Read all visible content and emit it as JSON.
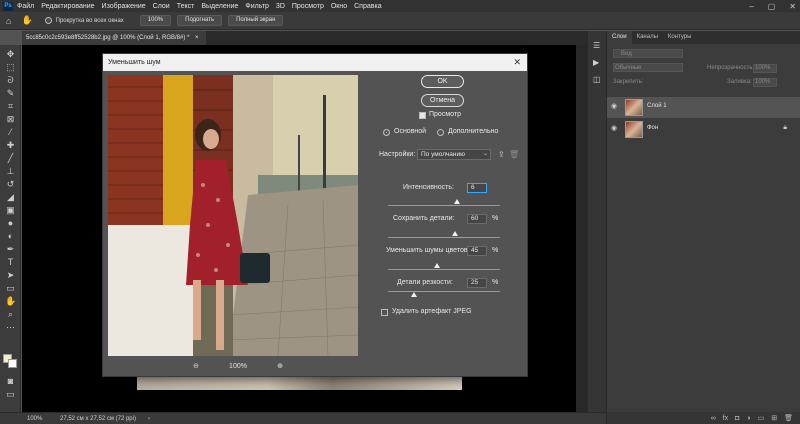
{
  "app": {
    "menu": [
      "Файл",
      "Редактирование",
      "Изображение",
      "Слои",
      "Текст",
      "Выделение",
      "Фильтр",
      "3D",
      "Просмотр",
      "Окно",
      "Справка"
    ],
    "logo": "Ps"
  },
  "options": {
    "scroll_all_label": "Прокрутка во всех окнах",
    "zoom_value": "100%",
    "fit_label": "Подогнать",
    "fullscreen_label": "Полный экран"
  },
  "document": {
    "tab_title": "5cc85c0c2c593e8ff52528b2.jpg @ 100% (Слой 1, RGB/8#) *"
  },
  "status": {
    "zoom": "100%",
    "size": "27,52 см x 27,52 см (72 ppi)"
  },
  "layers_panel": {
    "tabs": [
      "Слои",
      "Каналы",
      "Контуры"
    ],
    "search_placeholder": "Вид",
    "blend_mode": "Обычные",
    "opacity_label": "Непрозрачность:",
    "opacity_value": "100%",
    "lock_label": "Закрепить:",
    "fill_label": "Заливка:",
    "fill_value": "100%",
    "layers": [
      {
        "name": "Слой 1"
      },
      {
        "name": "Фон"
      }
    ]
  },
  "dialog": {
    "title": "Уменьшить шум",
    "ok_label": "OK",
    "cancel_label": "Отмена",
    "preview_label": "Просмотр",
    "basic_label": "Основной",
    "advanced_label": "Дополнительно",
    "settings_label": "Настройки:",
    "settings_value": "По умолчанию",
    "strength_label": "Интенсивность:",
    "strength_value": "6",
    "strength_max": 10,
    "preserve_label": "Сохранить детали:",
    "preserve_value": "60",
    "color_noise_label": "Уменьшить шумы цветов:",
    "color_noise_value": "45",
    "sharpen_label": "Детали резкости:",
    "sharpen_value": "25",
    "percent": "%",
    "jpeg_label": "Удалить артефакт JPEG",
    "zoom_value": "100%"
  },
  "icons": {
    "eye": "eye-icon",
    "lock": "lock-icon",
    "zoom_in": "zoom-in-icon",
    "zoom_out": "zoom-out-icon"
  },
  "colors": {
    "accent": "#31a8ff",
    "dialog_bg": "#535353",
    "panel_bg": "#3c3c3c"
  }
}
